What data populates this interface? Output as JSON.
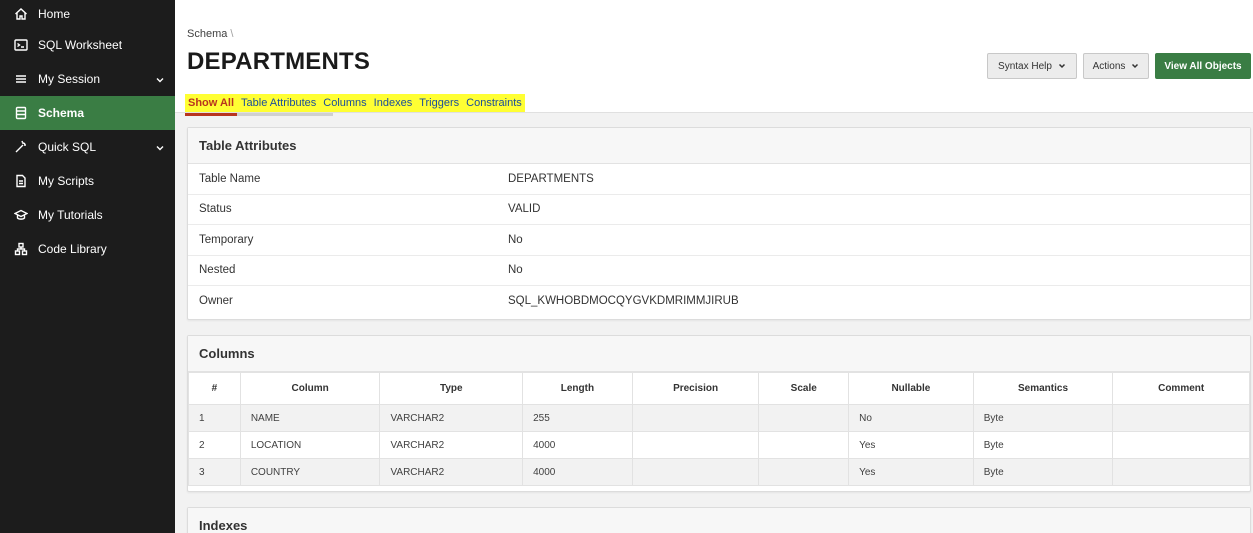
{
  "sidebar": {
    "items": [
      {
        "label": "Home",
        "icon": "home-icon"
      },
      {
        "label": "SQL Worksheet",
        "icon": "terminal-icon"
      },
      {
        "label": "My Session",
        "icon": "menu-icon"
      },
      {
        "label": "Schema",
        "icon": "database-icon"
      },
      {
        "label": "Quick SQL",
        "icon": "magic-wand-icon"
      },
      {
        "label": "My Scripts",
        "icon": "document-icon"
      },
      {
        "label": "My Tutorials",
        "icon": "graduation-cap-icon"
      },
      {
        "label": "Code Library",
        "icon": "hierarchy-icon"
      }
    ],
    "active_color": "#3a7d44"
  },
  "header": {
    "breadcrumb": "Schema",
    "breadcrumb_sep": "\\",
    "title": "DEPARTMENTS",
    "syntax_help_label": "Syntax Help",
    "actions_label": "Actions",
    "view_all_label": "View All Objects"
  },
  "tabs": [
    "Show All",
    "Table Attributes",
    "Columns",
    "Indexes",
    "Triggers",
    "Constraints"
  ],
  "attributes": {
    "title": "Table Attributes",
    "rows": [
      {
        "label": "Table Name",
        "value": "DEPARTMENTS"
      },
      {
        "label": "Status",
        "value": "VALID"
      },
      {
        "label": "Temporary",
        "value": "No"
      },
      {
        "label": "Nested",
        "value": "No"
      },
      {
        "label": "Owner",
        "value": "SQL_KWHOBDMOCQYGVKDMRIMMJIRUB"
      }
    ]
  },
  "columns": {
    "title": "Columns",
    "headers": [
      "#",
      "Column",
      "Type",
      "Length",
      "Precision",
      "Scale",
      "Nullable",
      "Semantics",
      "Comment"
    ],
    "rows": [
      [
        "1",
        "NAME",
        "VARCHAR2",
        "255",
        "",
        "",
        "No",
        "Byte",
        ""
      ],
      [
        "2",
        "LOCATION",
        "VARCHAR2",
        "4000",
        "",
        "",
        "Yes",
        "Byte",
        ""
      ],
      [
        "3",
        "COUNTRY",
        "VARCHAR2",
        "4000",
        "",
        "",
        "Yes",
        "Byte",
        ""
      ]
    ]
  },
  "indexes": {
    "title": "Indexes"
  }
}
